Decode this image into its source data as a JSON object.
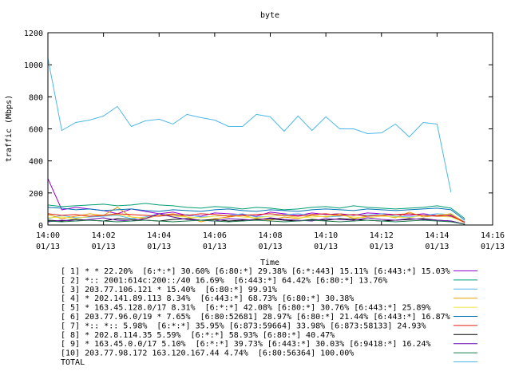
{
  "chart_data": {
    "type": "line",
    "title": "byte",
    "xlabel": "Time",
    "ylabel": "traffic (Mbps)",
    "ylim": [
      0,
      1200
    ],
    "xlim": [
      0,
      16
    ],
    "x_unit": "minutes after 14:00 on 01/13",
    "y_ticks": [
      0,
      200,
      400,
      600,
      800,
      1000,
      1200
    ],
    "x_ticks": [
      {
        "time": "14:00",
        "date": "01/13"
      },
      {
        "time": "14:02",
        "date": "01/13"
      },
      {
        "time": "14:04",
        "date": "01/13"
      },
      {
        "time": "14:06",
        "date": "01/13"
      },
      {
        "time": "14:08",
        "date": "01/13"
      },
      {
        "time": "14:10",
        "date": "01/13"
      },
      {
        "time": "14:12",
        "date": "01/13"
      },
      {
        "time": "14:14",
        "date": "01/13"
      },
      {
        "time": "14:16",
        "date": "01/13"
      }
    ],
    "grid": false,
    "legend_position": "bottom",
    "x": [
      0,
      0.5,
      1,
      1.5,
      2,
      2.5,
      3,
      3.5,
      4,
      4.5,
      5,
      5.5,
      6,
      6.5,
      7,
      7.5,
      8,
      8.5,
      9,
      9.5,
      10,
      10.5,
      11,
      11.5,
      12,
      12.5,
      13,
      13.5,
      14,
      14.5,
      15
    ],
    "series": [
      {
        "name": "[ 1] * * 22.20%  [6:*:*] 30.60% [6:80:*] 29.38% [6:*:443] 15.11% [6:443:*] 15.03%",
        "color": "#9400d3",
        "values": [
          290,
          95,
          110,
          100,
          90,
          70,
          100,
          85,
          70,
          80,
          60,
          55,
          75,
          70,
          65,
          55,
          80,
          70,
          60,
          75,
          65,
          70,
          60,
          75,
          70,
          65,
          60,
          70,
          60,
          55,
          20
        ]
      },
      {
        "name": "[ 2] *:: 2001:614c:200::/40 16.69%  [6:443:*] 64.42% [6:80:*] 13.76%",
        "color": "#009e73",
        "values": [
          125,
          115,
          120,
          125,
          130,
          120,
          125,
          135,
          125,
          120,
          110,
          105,
          115,
          110,
          100,
          110,
          105,
          95,
          100,
          110,
          115,
          105,
          120,
          110,
          105,
          100,
          105,
          110,
          120,
          105,
          40
        ]
      },
      {
        "name": "[ 3] 203.77.106.121 * 15.40%  [6:80:*] 99.91%",
        "color": "#56b4e9",
        "values": [
          40,
          60,
          45,
          50,
          55,
          60,
          40,
          50,
          70,
          55,
          65,
          50,
          55,
          60,
          70,
          50,
          55,
          65,
          70,
          60,
          50,
          55,
          65,
          60,
          70,
          55,
          50,
          60,
          70,
          65,
          20
        ]
      },
      {
        "name": "[ 4] * 202.141.89.113 8.34%  [6:443:*] 68.73% [6:80:*] 30.38%",
        "color": "#e69f00",
        "values": [
          65,
          40,
          55,
          70,
          60,
          110,
          50,
          40,
          60,
          70,
          50,
          20,
          40,
          50,
          60,
          40,
          30,
          50,
          40,
          60,
          50,
          70,
          40,
          55,
          60,
          45,
          80,
          50,
          60,
          70,
          15
        ]
      },
      {
        "name": "[ 5] * 163.45.128.0/17 8.31%  [6:*:*] 42.08% [6:80:*] 30.76% [6:443:*] 25.89%",
        "color": "#f0e442",
        "values": [
          45,
          50,
          40,
          55,
          60,
          65,
          50,
          45,
          60,
          55,
          50,
          45,
          55,
          60,
          50,
          45,
          55,
          60,
          45,
          50,
          55,
          60,
          50,
          45,
          55,
          50,
          45,
          60,
          55,
          50,
          15
        ]
      },
      {
        "name": "[ 6] 203.77.96.0/19 * 7.65%  [6:80:52681] 28.97% [6:80:*] 21.44% [6:443:*] 16.87%",
        "color": "#0072b2",
        "values": [
          110,
          105,
          95,
          100,
          90,
          95,
          100,
          90,
          85,
          95,
          90,
          85,
          95,
          100,
          90,
          85,
          95,
          90,
          85,
          95,
          100,
          95,
          90,
          100,
          95,
          90,
          95,
          100,
          105,
          95,
          30
        ]
      },
      {
        "name": "[ 7] *:: *:: 5.98%  [6:*:*] 35.95% [6:873:59664] 33.98% [6:873:58133] 24.93%",
        "color": "#e51e10",
        "values": [
          70,
          60,
          65,
          55,
          60,
          70,
          65,
          60,
          55,
          65,
          60,
          70,
          65,
          55,
          60,
          65,
          70,
          60,
          55,
          65,
          70,
          60,
          65,
          55,
          60,
          65,
          70,
          60,
          55,
          60,
          15
        ]
      },
      {
        "name": "[ 8] * 202.8.114.35 5.59%  [6:*:*] 58.93% [6:80:*] 40.47%",
        "color": "#000000",
        "values": [
          30,
          25,
          35,
          30,
          25,
          40,
          35,
          30,
          25,
          35,
          40,
          30,
          35,
          25,
          30,
          35,
          40,
          30,
          25,
          35,
          30,
          40,
          35,
          30,
          25,
          30,
          35,
          40,
          30,
          25,
          5
        ]
      },
      {
        "name": "[ 9] * 163.45.0.0/17 5.10%  [6:*:*] 39.73% [6:443:*] 30.03% [6:9418:*] 16.24%",
        "color": "#6a0dad",
        "values": [
          20,
          30,
          25,
          35,
          45,
          30,
          25,
          40,
          70,
          50,
          35,
          30,
          25,
          40,
          35,
          30,
          45,
          35,
          30,
          25,
          40,
          35,
          30,
          45,
          35,
          30,
          40,
          35,
          30,
          25,
          5
        ]
      },
      {
        "name": "[10] 203.77.98.172 163.120.167.44 4.74%  [6:80:56364] 100.00%",
        "color": "#1f7a4d",
        "values": [
          25,
          20,
          25,
          30,
          25,
          20,
          25,
          30,
          25,
          20,
          25,
          30,
          25,
          20,
          25,
          30,
          25,
          20,
          25,
          30,
          25,
          20,
          25,
          30,
          25,
          20,
          25,
          30,
          25,
          20,
          5
        ]
      },
      {
        "name": "TOTAL",
        "color": "#4db8e8",
        "values": [
          1040,
          590,
          640,
          655,
          680,
          740,
          615,
          650,
          660,
          630,
          690,
          670,
          655,
          615,
          615,
          690,
          675,
          585,
          680,
          590,
          675,
          600,
          600,
          570,
          575,
          630,
          550,
          640,
          630,
          205,
          null
        ]
      }
    ]
  }
}
